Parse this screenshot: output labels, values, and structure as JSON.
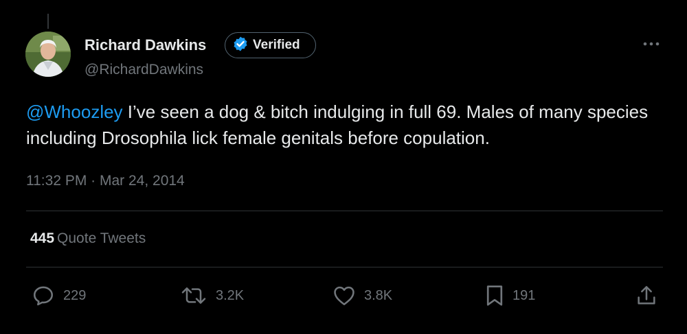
{
  "author": {
    "display_name": "Richard Dawkins",
    "handle": "@RichardDawkins",
    "verified_label": "Verified",
    "avatar_icon": "profile-photo"
  },
  "tweet": {
    "mention": "@Whoozley",
    "text": " I’ve seen a dog & bitch indulging in full 69. Males of many species including Drosophila lick female genitals before copulation.",
    "timestamp": "11:32 PM · Mar 24, 2014"
  },
  "stats": {
    "quote_count": "445",
    "quote_label": "Quote Tweets"
  },
  "actions": {
    "replies": "229",
    "retweets": "3.2K",
    "likes": "3.8K",
    "bookmarks": "191"
  },
  "colors": {
    "background": "#000000",
    "text_primary": "#e7e9ea",
    "text_secondary": "#71767b",
    "accent": "#1d9bf0",
    "divider": "#2f3336"
  },
  "icons": [
    "avatar",
    "verified-badge-icon",
    "more-icon",
    "reply-icon",
    "retweet-icon",
    "like-icon",
    "bookmark-icon",
    "share-icon"
  ]
}
